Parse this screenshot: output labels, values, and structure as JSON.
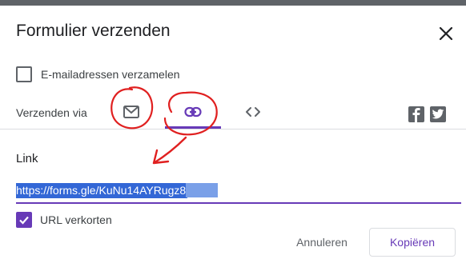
{
  "dialog": {
    "title": "Formulier verzenden"
  },
  "collect_emails": {
    "label": "E-mailadressen verzamelen",
    "checked": false
  },
  "send_via": {
    "label": "Verzenden via",
    "tabs": [
      {
        "id": "email",
        "icon": "mail-icon",
        "selected": false
      },
      {
        "id": "link",
        "icon": "link-icon",
        "selected": true
      },
      {
        "id": "embed",
        "icon": "code-icon",
        "selected": false
      }
    ],
    "share": [
      {
        "icon": "facebook-icon"
      },
      {
        "icon": "twitter-icon"
      }
    ]
  },
  "link_section": {
    "title": "Link",
    "url": "https://forms.gle/KuNu14AYRugz8",
    "shorten": {
      "label": "URL verkorten",
      "checked": true
    }
  },
  "actions": {
    "cancel": "Annuleren",
    "copy": "Kopiëren"
  },
  "colors": {
    "accent": "#673ab7",
    "annotation": "#e02020",
    "selection": "#3367d6"
  }
}
